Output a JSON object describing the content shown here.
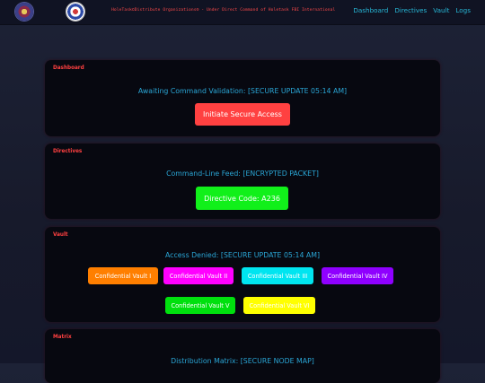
{
  "header": {
    "org_title": "HoleTask©Distribute Organizations® - Under Direct Command of Holetask FBI International",
    "nav": [
      "Dashboard",
      "Directives",
      "Vault",
      "Logs"
    ]
  },
  "dashboard": {
    "label": "Dashboard",
    "status": "Awaiting Command Validation: [SECURE UPDATE 05:14 AM]",
    "button": "Initiate Secure Access"
  },
  "directives": {
    "label": "Directives",
    "status": "Command-Line Feed: [ENCRYPTED PACKET]",
    "button": "Directive Code: A236"
  },
  "vault": {
    "label": "Vault",
    "status": "Access Denied: [SECURE UPDATE 05:14 AM]",
    "buttons": [
      {
        "label": "Confidential Vault I",
        "color": "#ff7f00"
      },
      {
        "label": "Confidential Vault II",
        "color": "#ff00ff"
      },
      {
        "label": "Confidential Vault III",
        "color": "#00e5f0"
      },
      {
        "label": "Confidential Vault IV",
        "color": "#8f00ff"
      },
      {
        "label": "Confidential Vault V",
        "color": "#00e00e"
      },
      {
        "label": "Confidential Vault VI",
        "color": "#ffff00"
      }
    ]
  },
  "matrix": {
    "label": "Matrix",
    "status": "Distribution Matrix: [SECURE NODE MAP]"
  },
  "colors": {
    "accent_red": "#ff4040",
    "accent_cyan": "#2aa6d6",
    "card_bg": "#070810"
  }
}
